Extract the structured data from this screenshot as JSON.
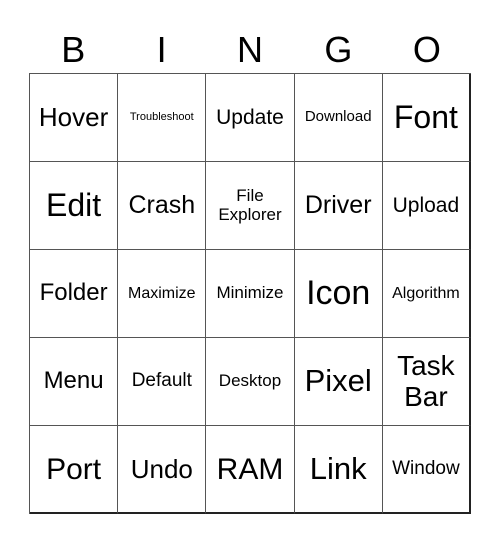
{
  "header": [
    "B",
    "I",
    "N",
    "G",
    "O"
  ],
  "cells": [
    "Hover",
    "Troubleshoot",
    "Update",
    "Download",
    "Font",
    "Edit",
    "Crash",
    "File Explorer",
    "Driver",
    "Upload",
    "Folder",
    "Maximize",
    "Minimize",
    "Icon",
    "Algorithm",
    "Menu",
    "Default",
    "Desktop",
    "Pixel",
    "Task Bar",
    "Port",
    "Undo",
    "RAM",
    "Link",
    "Window"
  ]
}
